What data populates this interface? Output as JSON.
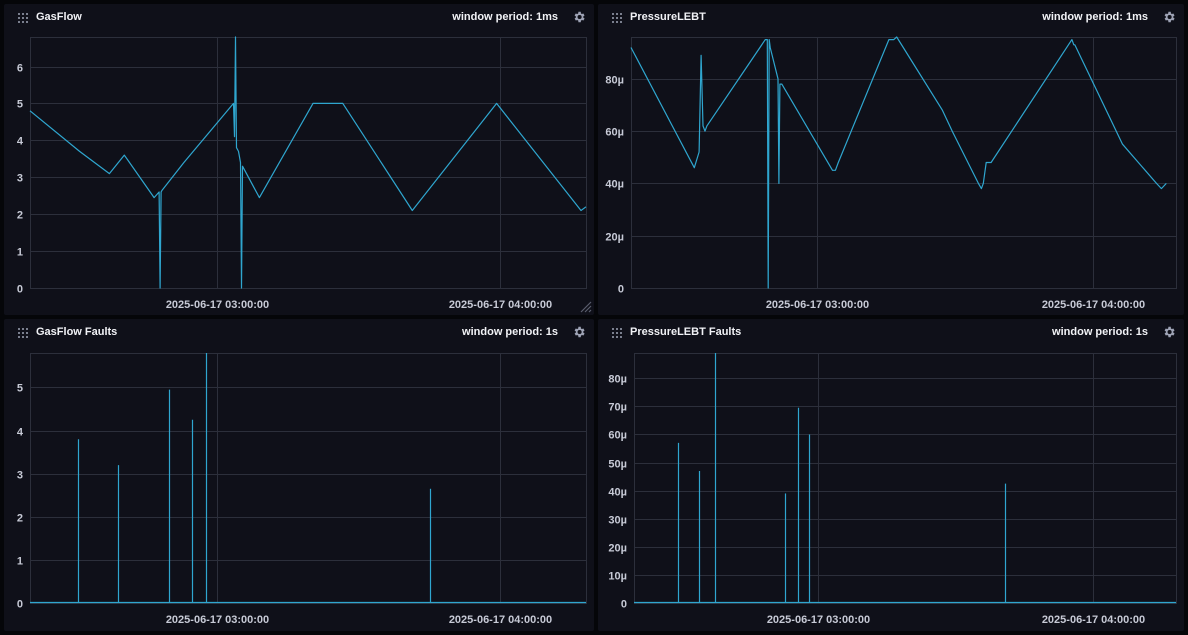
{
  "colors": {
    "line": "#2fa6cf",
    "grid": "#2c2f3b",
    "axis": "#c7cad6"
  },
  "icons": {
    "drag": "drag-handle-icon",
    "settings": "gear-icon",
    "resize": "resize-handle-icon"
  },
  "panels": [
    {
      "title": "GasFlow",
      "window_label": "window period: 1ms",
      "chart_data": {
        "type": "line",
        "x_ticks": [
          "2025-06-17 03:00:00",
          "2025-06-17 04:00:00"
        ],
        "ylim": [
          0,
          6.8
        ],
        "y_ticks": [
          "0",
          "1",
          "2",
          "3",
          "4",
          "5",
          "6"
        ],
        "y_tick_values": [
          0,
          1,
          2,
          3,
          4,
          5,
          6
        ],
        "series": [
          {
            "x": [
              0,
              5,
              8,
              9.5,
              12.5,
              13,
              13.1,
              13.2,
              13.3,
              15.5,
              20.5,
              20.6,
              20.7,
              20.8,
              21,
              21.2,
              21.3,
              21.4,
              23.1,
              28.5,
              31.5,
              38.5,
              47,
              55.5,
              56
            ],
            "y": [
              4.8,
              3.7,
              3.1,
              3.6,
              2.45,
              2.6,
              0.0,
              2.6,
              2.65,
              3.4,
              5.0,
              4.1,
              6.8,
              3.8,
              3.7,
              3.4,
              0.0,
              3.3,
              2.45,
              5.0,
              5.0,
              2.1,
              5.0,
              2.1,
              2.2
            ]
          }
        ]
      }
    },
    {
      "title": "PressureLEBT",
      "window_label": "window period: 1ms",
      "chart_data": {
        "type": "line",
        "x_ticks": [
          "2025-06-17 03:00:00",
          "2025-06-17 04:00:00"
        ],
        "ylim": [
          0,
          96
        ],
        "y_ticks": [
          "0",
          "20µ",
          "40µ",
          "60µ",
          "80µ"
        ],
        "y_tick_values": [
          0,
          20,
          40,
          60,
          80
        ],
        "series": [
          {
            "x": [
              0,
              6.5,
              7.0,
              7.2,
              7.4,
              7.6,
              7.8,
              13.8,
              14.0,
              14.1,
              14.2,
              14.3,
              15.1,
              15.2,
              15.3,
              15.5,
              20.7,
              21.0,
              21.3,
              26.5,
              27.0,
              27.3,
              32.0,
              33.0,
              35.7,
              36.0,
              36.2,
              36.5,
              37.0,
              45.3,
              45.5,
              45.6,
              50.5,
              54.0,
              54.5,
              55.0
            ],
            "y": [
              92,
              46,
              52,
              89,
              62,
              60,
              62,
              95,
              95,
              0,
              95,
              92,
              80,
              40,
              78,
              78,
              45,
              45,
              48,
              95,
              95,
              96,
              68,
              60,
              40,
              38,
              40,
              48,
              48,
              95,
              93,
              93,
              55,
              40,
              38,
              40
            ]
          }
        ]
      }
    },
    {
      "title": "GasFlow Faults",
      "window_label": "window period: 1s",
      "chart_data": {
        "type": "line",
        "x_ticks": [
          "2025-06-17 03:00:00",
          "2025-06-17 04:00:00"
        ],
        "ylim": [
          0,
          5.8
        ],
        "y_ticks": [
          "0",
          "1",
          "2",
          "3",
          "4",
          "5"
        ],
        "y_tick_values": [
          0,
          1,
          2,
          3,
          4,
          5
        ],
        "spikes": {
          "x": [
            4.8,
            8.9,
            14.0,
            16.3,
            17.7,
            40.3
          ],
          "y": [
            3.8,
            3.2,
            4.95,
            4.25,
            5.8,
            2.65
          ]
        }
      }
    },
    {
      "title": "PressureLEBT Faults",
      "window_label": "window period: 1s",
      "chart_data": {
        "type": "line",
        "x_ticks": [
          "2025-06-17 03:00:00",
          "2025-06-17 04:00:00"
        ],
        "ylim": [
          0,
          89
        ],
        "y_ticks": [
          "0",
          "10µ",
          "20µ",
          "30µ",
          "40µ",
          "50µ",
          "60µ",
          "70µ",
          "80µ"
        ],
        "y_tick_values": [
          0,
          10,
          20,
          30,
          40,
          50,
          60,
          70,
          80
        ],
        "spikes": {
          "x": [
            4.5,
            6.7,
            8.4,
            15.6,
            16.9,
            18.1,
            38.3
          ],
          "y": [
            57,
            47,
            89,
            39,
            69.5,
            60,
            42.5
          ]
        }
      }
    }
  ]
}
